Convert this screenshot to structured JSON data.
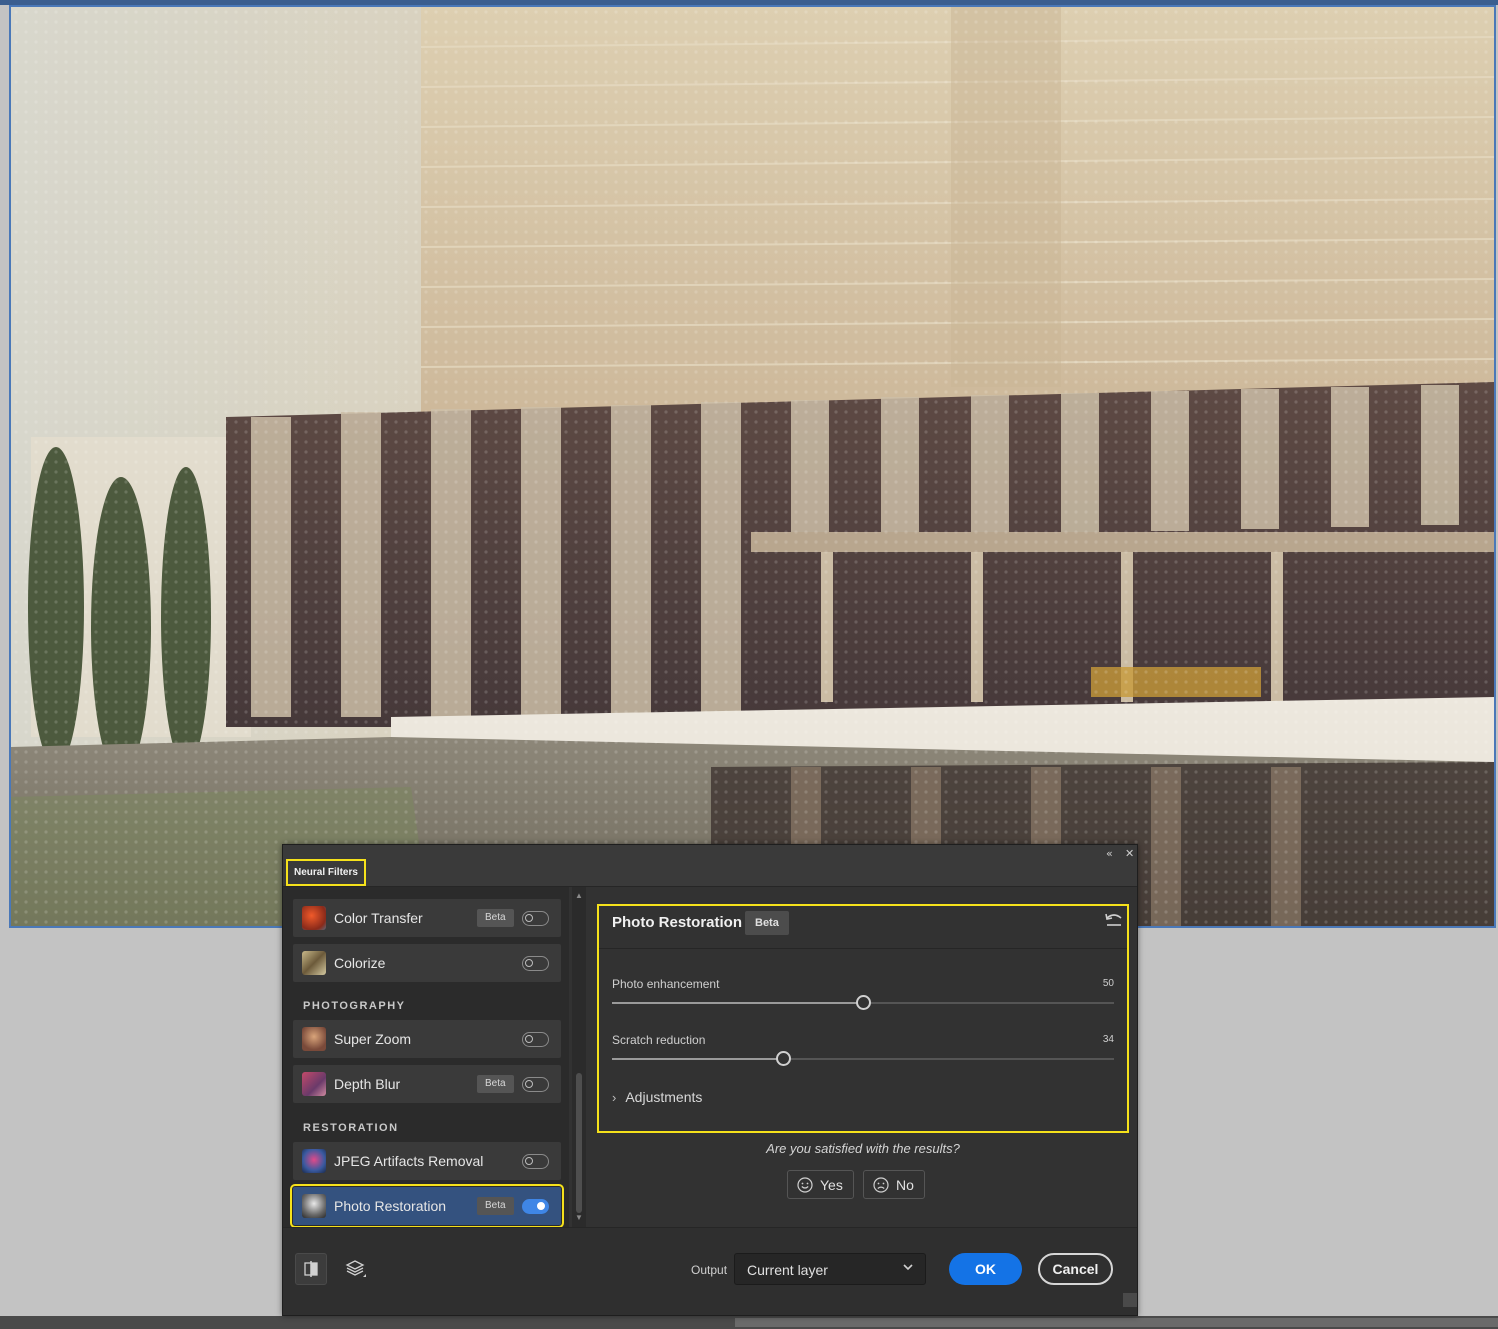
{
  "dialog": {
    "title": "Neural Filters",
    "window_controls": {
      "collapse_icon": "double-chevron-left-icon",
      "close_icon": "close-icon"
    }
  },
  "filters": {
    "items_top": [
      {
        "label": "Color Transfer",
        "beta": "Beta",
        "enabled": false,
        "icon": "color-transfer-thumbnail"
      },
      {
        "label": "Colorize",
        "beta": "",
        "enabled": false,
        "icon": "colorize-thumbnail"
      }
    ],
    "photography": {
      "heading": "PHOTOGRAPHY",
      "items": [
        {
          "label": "Super Zoom",
          "beta": "",
          "enabled": false,
          "icon": "super-zoom-thumbnail"
        },
        {
          "label": "Depth Blur",
          "beta": "Beta",
          "enabled": false,
          "icon": "depth-blur-thumbnail"
        }
      ]
    },
    "restoration": {
      "heading": "RESTORATION",
      "items": [
        {
          "label": "JPEG Artifacts Removal",
          "beta": "",
          "enabled": false,
          "icon": "jpeg-artifacts-thumbnail"
        },
        {
          "label": "Photo Restoration",
          "beta": "Beta",
          "enabled": true,
          "selected": true,
          "icon": "photo-restoration-thumbnail"
        }
      ]
    }
  },
  "panel": {
    "title": "Photo Restoration",
    "beta": "Beta",
    "reset_icon": "reset-icon",
    "sliders": [
      {
        "label": "Photo enhancement",
        "value": "50",
        "fraction": 0.5
      },
      {
        "label": "Scratch reduction",
        "value": "34",
        "fraction": 0.34
      }
    ],
    "adjustments_label": "Adjustments"
  },
  "feedback": {
    "question": "Are you satisfied with the results?",
    "yes_label": "Yes",
    "no_label": "No"
  },
  "footer": {
    "output_label": "Output",
    "output_value": "Current layer",
    "ok_label": "OK",
    "cancel_label": "Cancel"
  },
  "colors": {
    "highlight": "#f5e11b",
    "accent": "#1473e6",
    "dialog_bg": "#323232"
  }
}
